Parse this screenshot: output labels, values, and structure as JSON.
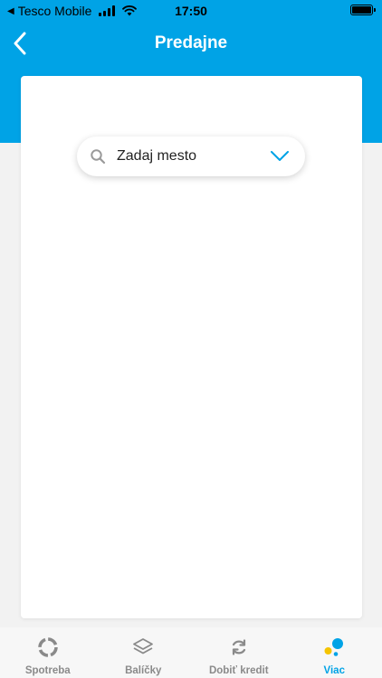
{
  "status_bar": {
    "carrier": "Tesco Mobile",
    "time": "17:50"
  },
  "nav": {
    "title": "Predajne",
    "back_icon": "chevron-left-icon"
  },
  "search": {
    "placeholder": "Zadaj mesto",
    "icon": "search-icon",
    "dropdown_icon": "chevron-down-icon"
  },
  "tabs": [
    {
      "label": "Spotreba",
      "icon": "usage-ring-icon",
      "active": false
    },
    {
      "label": "Balíčky",
      "icon": "layers-icon",
      "active": false
    },
    {
      "label": "Dobiť kredit",
      "icon": "refresh-icon",
      "active": false
    },
    {
      "label": "Viac",
      "icon": "more-dots-icon",
      "active": true
    }
  ],
  "colors": {
    "brand_blue": "#00a3e6",
    "inactive_gray": "#8a8a8a",
    "accent_yellow": "#f5c400"
  }
}
